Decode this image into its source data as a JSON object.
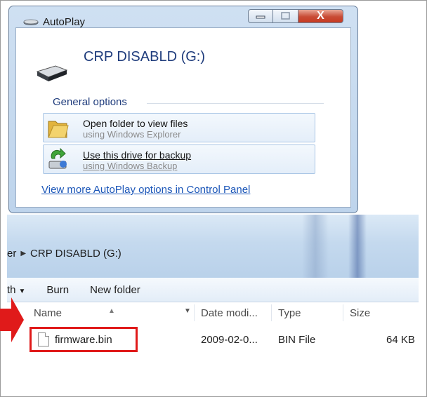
{
  "dialog": {
    "title": "AutoPlay",
    "drive_label": "CRP DISABLD (G:)",
    "general_options_label": "General options",
    "options": [
      {
        "title": "Open folder to view files",
        "subtitle": "using Windows Explorer",
        "icon": "folder-icon"
      },
      {
        "title": "Use this drive for backup",
        "subtitle": "using Windows Backup",
        "icon": "backup-icon"
      }
    ],
    "more_link": "View more AutoPlay options in Control Panel",
    "close_glyph": "X"
  },
  "explorer": {
    "breadcrumb_prefix": "er",
    "breadcrumb_location": "CRP DISABLD (G:)",
    "toolbar": {
      "partial_item": "th",
      "burn": "Burn",
      "new_folder": "New folder"
    },
    "columns": {
      "name": "Name",
      "date": "Date modi...",
      "type": "Type",
      "size": "Size"
    },
    "files": [
      {
        "name": "firmware.bin",
        "date": "2009-02-0...",
        "type": "BIN File",
        "size": "64 KB"
      }
    ]
  },
  "colors": {
    "highlight": "#e01a1a",
    "link": "#1b56b8",
    "heading": "#1f3c7c"
  }
}
